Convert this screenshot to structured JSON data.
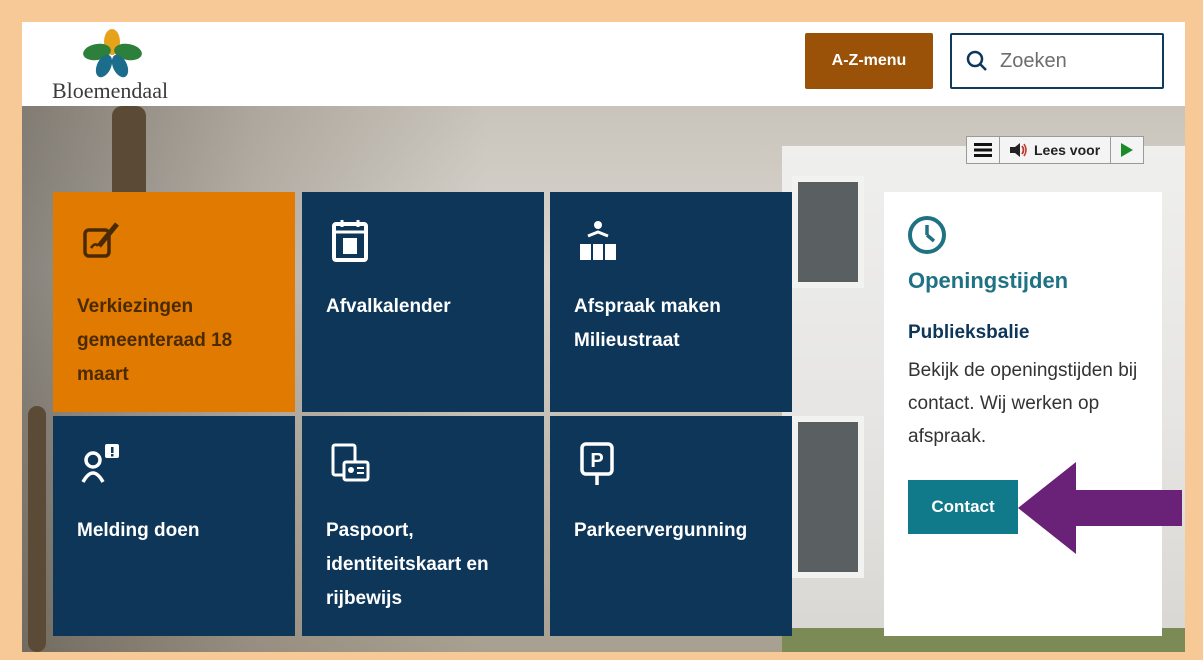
{
  "header": {
    "logo_text": "Bloemendaal",
    "az_menu_label": "A-Z-menu",
    "search_placeholder": "Zoeken"
  },
  "readspeaker": {
    "label": "Lees voor"
  },
  "tiles": [
    {
      "label": "Verkiezingen gemeenteraad 18 maart",
      "icon": "ballot-pencil-icon"
    },
    {
      "label": "Afvalkalender",
      "icon": "calendar-bin-icon"
    },
    {
      "label": "Afspraak maken Milieustraat",
      "icon": "recycling-person-icon"
    },
    {
      "label": "Melding doen",
      "icon": "report-person-icon"
    },
    {
      "label": "Paspoort, identiteitskaart en rijbewijs",
      "icon": "id-card-icon"
    },
    {
      "label": "Parkeervergunning",
      "icon": "parking-sign-icon"
    }
  ],
  "side_panel": {
    "icon": "clock-icon",
    "title": "Openingstijden",
    "subtitle": "Publieksbalie",
    "text": "Bekijk de openingstijden bij contact. Wij werken op afspraak.",
    "button_label": "Contact"
  },
  "colors": {
    "frame": "#f6c996",
    "tile_blue": "#0d3659",
    "tile_orange": "#e07a00",
    "az_button": "#9a5209",
    "contact_button": "#107a8a",
    "arrow": "#6a2178"
  }
}
